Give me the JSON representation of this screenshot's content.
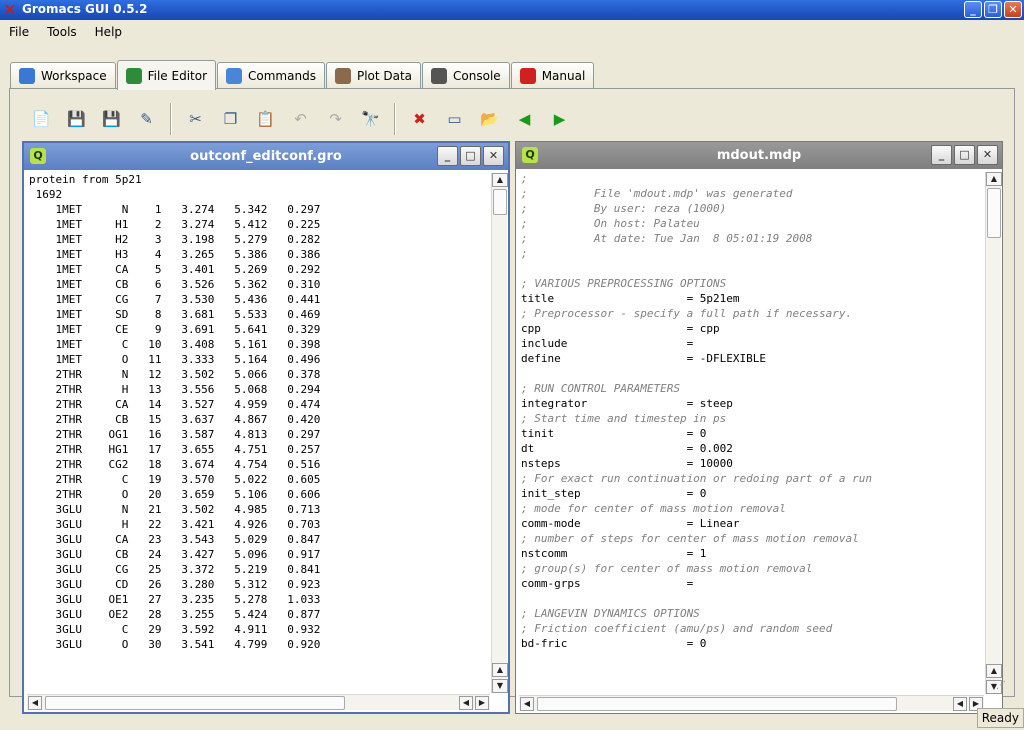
{
  "window": {
    "title": "Gromacs GUI 0.5.2"
  },
  "menu": {
    "items": [
      "File",
      "Tools",
      "Help"
    ]
  },
  "tabs": [
    {
      "label": "Workspace",
      "icon": "folder-icon",
      "color": "#3a78d4"
    },
    {
      "label": "File Editor",
      "icon": "book-icon",
      "color": "#2e8b3a"
    },
    {
      "label": "Commands",
      "icon": "gear-icon",
      "color": "#4a86d8"
    },
    {
      "label": "Plot Data",
      "icon": "plot-icon",
      "color": "#8a6a4a"
    },
    {
      "label": "Console",
      "icon": "console-icon",
      "color": "#555555"
    },
    {
      "label": "Manual",
      "icon": "lifebuoy-icon",
      "color": "#d02020"
    }
  ],
  "active_tab": "File Editor",
  "toolbar": [
    "new-file-icon",
    "open-file-icon",
    "save-icon",
    "save-as-icon",
    "cut-icon",
    "copy-icon",
    "paste-icon",
    "undo-icon",
    "redo-icon",
    "find-icon",
    "close-file-icon",
    "split-icon",
    "open-folder-icon",
    "back-arrow-icon",
    "forward-arrow-icon"
  ],
  "left_pane": {
    "title": "outconf_editconf.gro",
    "lines": [
      "protein from 5p21",
      " 1692",
      "    1MET      N    1   3.274   5.342   0.297",
      "    1MET     H1    2   3.274   5.412   0.225",
      "    1MET     H2    3   3.198   5.279   0.282",
      "    1MET     H3    4   3.265   5.386   0.386",
      "    1MET     CA    5   3.401   5.269   0.292",
      "    1MET     CB    6   3.526   5.362   0.310",
      "    1MET     CG    7   3.530   5.436   0.441",
      "    1MET     SD    8   3.681   5.533   0.469",
      "    1MET     CE    9   3.691   5.641   0.329",
      "    1MET      C   10   3.408   5.161   0.398",
      "    1MET      O   11   3.333   5.164   0.496",
      "    2THR      N   12   3.502   5.066   0.378",
      "    2THR      H   13   3.556   5.068   0.294",
      "    2THR     CA   14   3.527   4.959   0.474",
      "    2THR     CB   15   3.637   4.867   0.420",
      "    2THR    OG1   16   3.587   4.813   0.297",
      "    2THR    HG1   17   3.655   4.751   0.257",
      "    2THR    CG2   18   3.674   4.754   0.516",
      "    2THR      C   19   3.570   5.022   0.605",
      "    2THR      O   20   3.659   5.106   0.606",
      "    3GLU      N   21   3.502   4.985   0.713",
      "    3GLU      H   22   3.421   4.926   0.703",
      "    3GLU     CA   23   3.543   5.029   0.847",
      "    3GLU     CB   24   3.427   5.096   0.917",
      "    3GLU     CG   25   3.372   5.219   0.841",
      "    3GLU     CD   26   3.280   5.312   0.923",
      "    3GLU    OE1   27   3.235   5.278   1.033",
      "    3GLU    OE2   28   3.255   5.424   0.877",
      "    3GLU      C   29   3.592   4.911   0.932",
      "    3GLU      O   30   3.541   4.799   0.920"
    ]
  },
  "right_pane": {
    "title": "mdout.mdp",
    "lines": [
      {
        "text": ";",
        "type": "comment"
      },
      {
        "text": ";          File 'mdout.mdp' was generated",
        "type": "comment"
      },
      {
        "text": ";          By user: reza (1000)",
        "type": "comment"
      },
      {
        "text": ";          On host: Palateu",
        "type": "comment"
      },
      {
        "text": ";          At date: Tue Jan  8 05:01:19 2008",
        "type": "comment"
      },
      {
        "text": ";",
        "type": "comment"
      },
      {
        "text": "",
        "type": "blank"
      },
      {
        "text": "; VARIOUS PREPROCESSING OPTIONS",
        "type": "comment"
      },
      {
        "text": "title                    = 5p21em",
        "type": "key"
      },
      {
        "text": "; Preprocessor - specify a full path if necessary.",
        "type": "comment"
      },
      {
        "text": "cpp                      = cpp",
        "type": "key"
      },
      {
        "text": "include                  =",
        "type": "key"
      },
      {
        "text": "define                   = -DFLEXIBLE",
        "type": "key"
      },
      {
        "text": "",
        "type": "blank"
      },
      {
        "text": "; RUN CONTROL PARAMETERS",
        "type": "comment"
      },
      {
        "text": "integrator               = steep",
        "type": "key"
      },
      {
        "text": "; Start time and timestep in ps",
        "type": "comment"
      },
      {
        "text": "tinit                    = 0",
        "type": "key"
      },
      {
        "text": "dt                       = 0.002",
        "type": "key"
      },
      {
        "text": "nsteps                   = 10000",
        "type": "key"
      },
      {
        "text": "; For exact run continuation or redoing part of a run",
        "type": "comment"
      },
      {
        "text": "init_step                = 0",
        "type": "key"
      },
      {
        "text": "; mode for center of mass motion removal",
        "type": "comment"
      },
      {
        "text": "comm-mode                = Linear",
        "type": "key"
      },
      {
        "text": "; number of steps for center of mass motion removal",
        "type": "comment"
      },
      {
        "text": "nstcomm                  = 1",
        "type": "key"
      },
      {
        "text": "; group(s) for center of mass motion removal",
        "type": "comment"
      },
      {
        "text": "comm-grps                =",
        "type": "key"
      },
      {
        "text": "",
        "type": "blank"
      },
      {
        "text": "; LANGEVIN DYNAMICS OPTIONS",
        "type": "comment"
      },
      {
        "text": "; Friction coefficient (amu/ps) and random seed",
        "type": "comment"
      },
      {
        "text": "bd-fric                  = 0",
        "type": "key"
      }
    ]
  },
  "status": {
    "text": "Ready"
  }
}
